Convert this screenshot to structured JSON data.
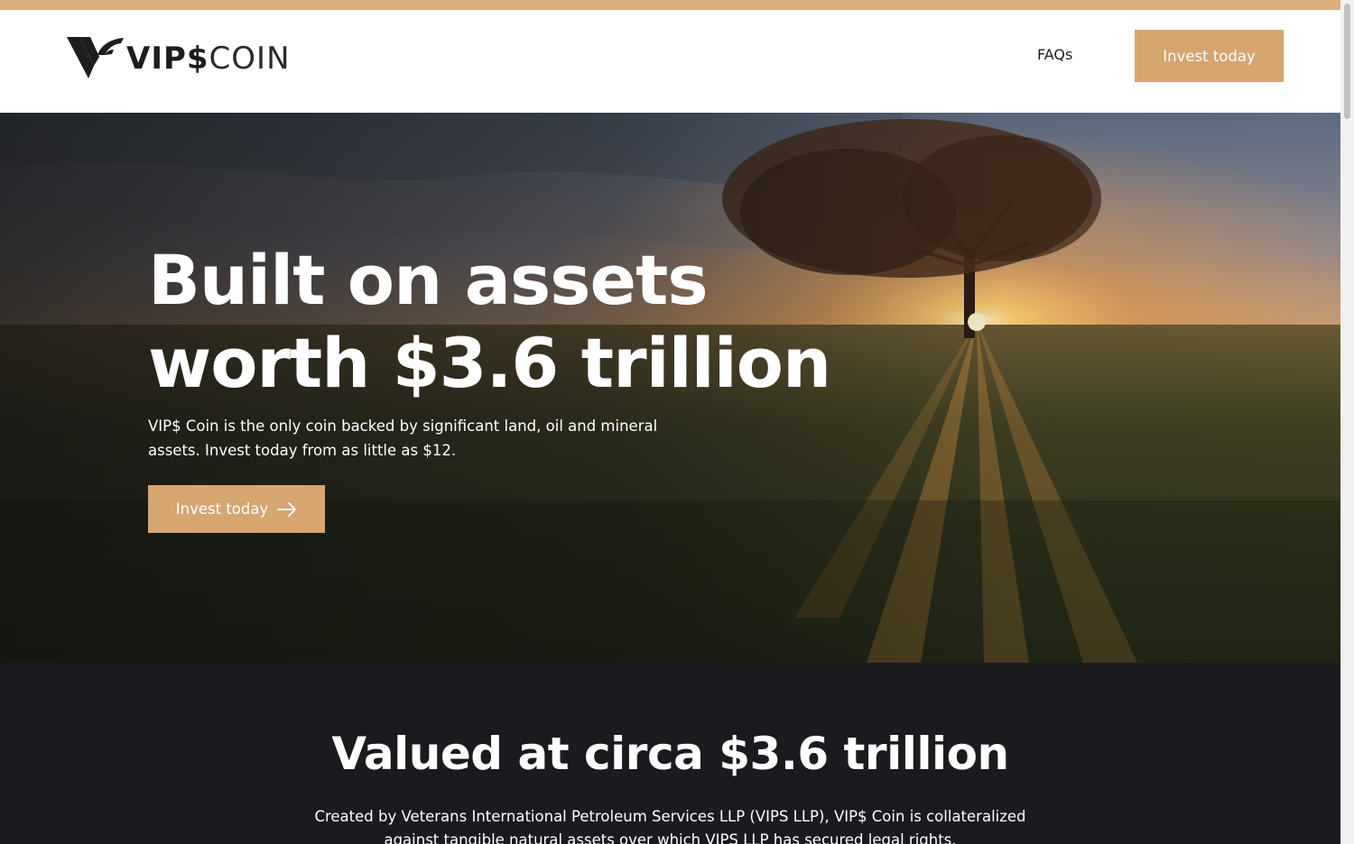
{
  "header": {
    "logo": {
      "strong": "VIP$",
      "light": "COIN"
    },
    "nav": {
      "faq_label": "FAQs"
    },
    "cta_label": "Invest today"
  },
  "hero": {
    "title_line1": "Built on assets",
    "title_line2": "worth $3.6 trillion",
    "subtitle": "VIP$ Coin is the only coin backed by significant land, oil and mineral assets. Invest today from as little as $12.",
    "cta_label": "Invest today",
    "cta_icon": "arrow-right-icon"
  },
  "valuation_section": {
    "title": "Valued at circa $3.6 trillion",
    "body": "Created by Veterans International Petroleum Services LLP (VIPS LLP), VIP$ Coin is collateralized against tangible natural assets over which VIPS LLP has secured legal rights."
  },
  "colors": {
    "accent": "#d6a570",
    "top_bar": "#dcae7a",
    "dark_section": "#1b1a1f",
    "text_dark": "#1d1d1f"
  }
}
